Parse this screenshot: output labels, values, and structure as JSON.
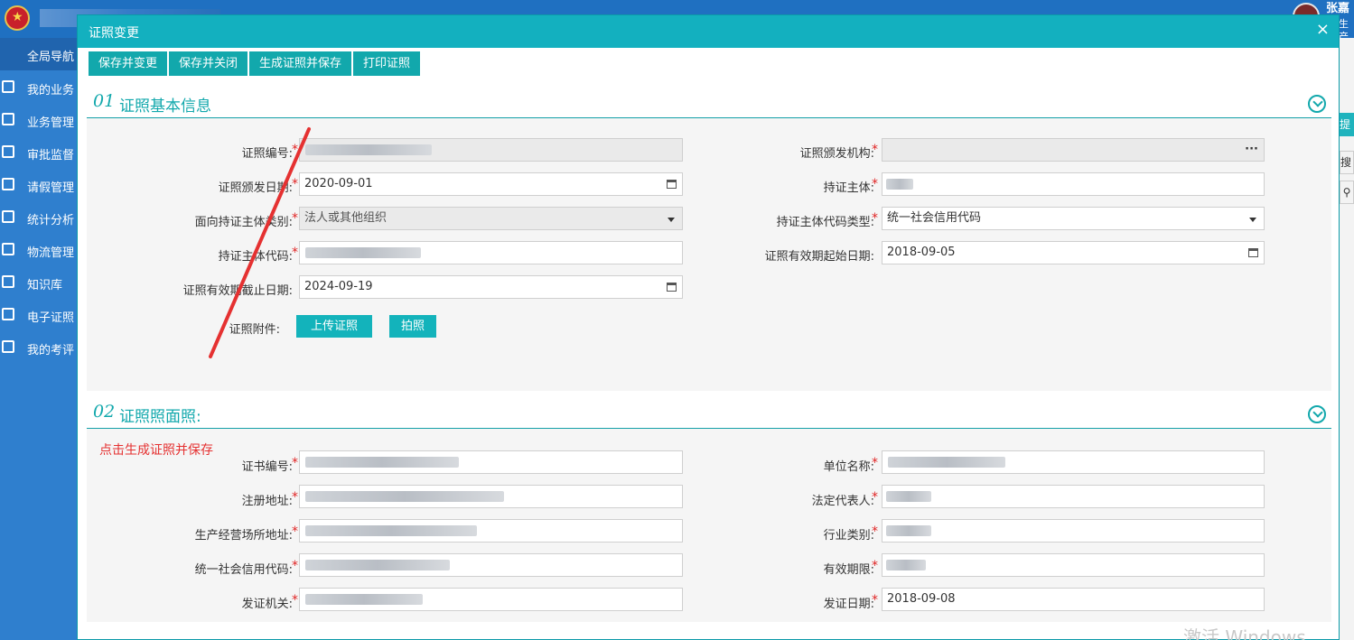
{
  "app": {
    "user_name": "张嘉",
    "user_role": "生产"
  },
  "sidebar": {
    "active": "全局导航",
    "items": [
      {
        "label": "我的业务",
        "icon": "calendar-icon"
      },
      {
        "label": "业务管理",
        "icon": "list-icon"
      },
      {
        "label": "审批监督",
        "icon": "check-list-icon"
      },
      {
        "label": "请假管理",
        "icon": "check-list-icon"
      },
      {
        "label": "统计分析",
        "icon": "bar-chart-icon"
      },
      {
        "label": "物流管理",
        "icon": "check-list-icon"
      },
      {
        "label": "知识库",
        "icon": "check-list-icon"
      },
      {
        "label": "电子证照",
        "icon": "check-list-icon"
      },
      {
        "label": "我的考评",
        "icon": "check-list-icon"
      }
    ]
  },
  "right_strip": {
    "btn1": "提交",
    "btn2": "搜索",
    "search_icon": "search-icon"
  },
  "modal": {
    "title": "证照变更",
    "close": "×",
    "toolbar": [
      "保存并变更",
      "保存并关闭",
      "生成证照并保存",
      "打印证照"
    ]
  },
  "section1": {
    "num": "01",
    "title": "证照基本信息",
    "fields": {
      "cert_no": {
        "label": "证照编号:",
        "value": ""
      },
      "issuer": {
        "label": "证照颁发机构:",
        "value": ""
      },
      "issue_date": {
        "label": "证照颁发日期:",
        "value": "2020-09-01"
      },
      "holder": {
        "label": "持证主体:",
        "value": ""
      },
      "holder_category": {
        "label": "面向持证主体类别:",
        "value": "法人或其他组织"
      },
      "holder_code_type": {
        "label": "持证主体代码类型:",
        "value": "统一社会信用代码"
      },
      "holder_code": {
        "label": "持证主体代码:",
        "value": ""
      },
      "valid_start": {
        "label": "证照有效期起始日期:",
        "value": "2018-09-05"
      },
      "valid_end": {
        "label": "证照有效期截止日期:",
        "value": "2024-09-19"
      },
      "attachment": {
        "label": "证照附件:"
      }
    },
    "upload_button": "上传证照",
    "photo_button": "拍照"
  },
  "section2": {
    "num": "02",
    "title": "证照照面照:",
    "fields": {
      "cert_number": {
        "label": "证书编号:",
        "value": ""
      },
      "unit_name": {
        "label": "单位名称:",
        "value": ""
      },
      "reg_address": {
        "label": "注册地址:",
        "value": ""
      },
      "legal_rep": {
        "label": "法定代表人:",
        "value": ""
      },
      "biz_address": {
        "label": "生产经营场所地址:",
        "value": ""
      },
      "industry": {
        "label": "行业类别:",
        "value": ""
      },
      "credit_code": {
        "label": "统一社会信用代码:",
        "value": ""
      },
      "validity": {
        "label": "有效期限:",
        "value": ""
      },
      "issuing_org": {
        "label": "发证机关:",
        "value": ""
      },
      "issue_date": {
        "label": "发证日期:",
        "value": "2018-09-08"
      }
    }
  },
  "annotation": "点击生成证照并保存",
  "watermark": "激活 Windows",
  "colors": {
    "accent": "#13b0bf",
    "sidebar": "#2f7fce",
    "required": "#e02424",
    "annotation": "#e53131"
  }
}
